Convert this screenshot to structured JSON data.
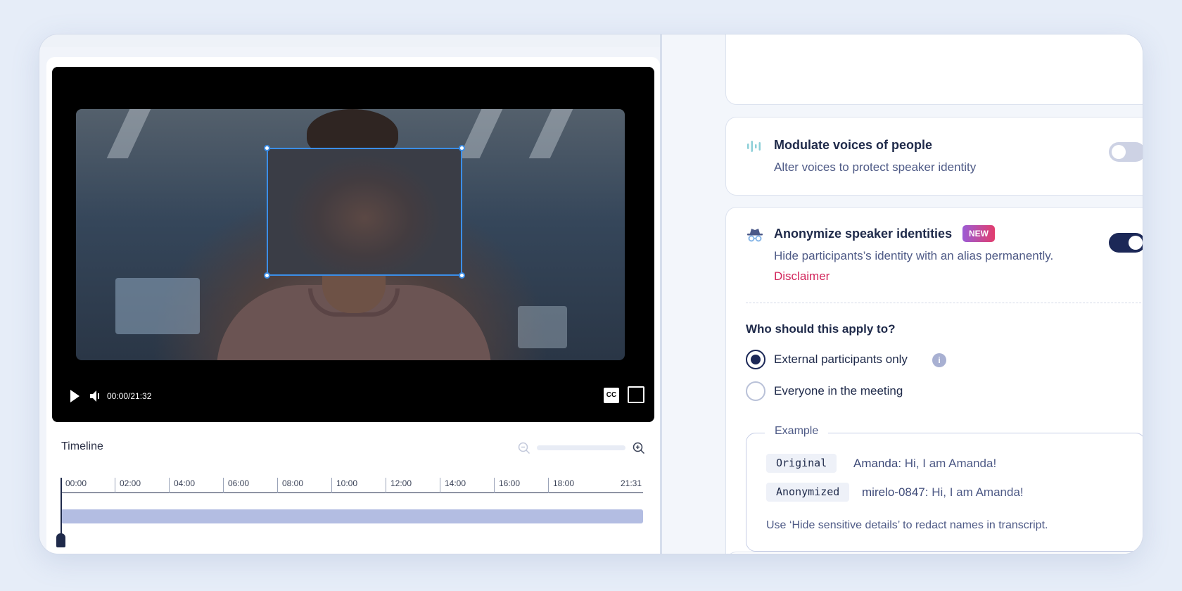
{
  "video": {
    "time": "00:00/21:32",
    "cc_label": "CC"
  },
  "timeline": {
    "title": "Timeline",
    "ticks": [
      "00:00",
      "02:00",
      "04:00",
      "06:00",
      "08:00",
      "10:00",
      "12:00",
      "14:00",
      "16:00",
      "18:00"
    ],
    "end_label": "21:31",
    "playhead_fraction": 0
  },
  "settings": {
    "modulate": {
      "title": "Modulate voices of people",
      "description": "Alter voices to protect speaker identity",
      "enabled": false
    },
    "anonymize": {
      "title": "Anonymize speaker identities",
      "badge": "NEW",
      "description": "Hide participants’s identity with an alias permanently.",
      "disclaimer": "Disclaimer",
      "enabled": true,
      "question": "Who should this apply to?",
      "options": [
        {
          "label": "External participants only",
          "checked": true
        },
        {
          "label": "Everyone in the meeting",
          "checked": false
        }
      ],
      "info_glyph": "i",
      "example": {
        "legend": "Example",
        "original_chip": "Original",
        "original_speaker": "Amanda:",
        "original_text": "Hi, I am Amanda!",
        "anonymized_chip": "Anonymized",
        "anonymized_speaker": "mirelo-0847:",
        "anonymized_text": "Hi, I am Amanda!",
        "note": "Use ‘Hide sensitive details’ to redact names in transcript."
      }
    }
  },
  "colors": {
    "accent": "#1c2857",
    "link": "#d2285d",
    "selection": "#3b8ee8"
  },
  "icons": {
    "modulate": "audio-waveform-icon",
    "anonymize": "incognito-spy-icon",
    "play": "play-icon",
    "volume": "volume-icon",
    "fullscreen": "fullscreen-icon",
    "zoom_out": "zoom-out-icon",
    "zoom_in": "zoom-in-icon",
    "info": "info-icon"
  }
}
